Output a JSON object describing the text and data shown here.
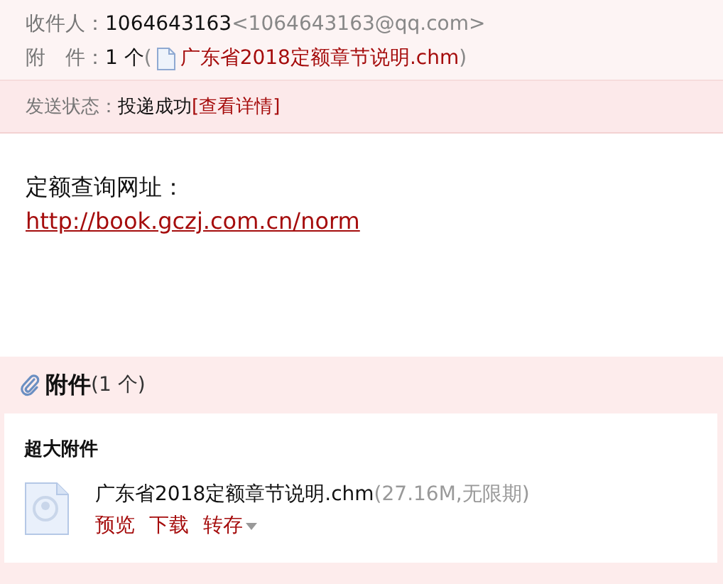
{
  "header": {
    "recipient_label": "收件人：",
    "recipient_name": "1064643163",
    "recipient_email": "<1064643163@qq.com>",
    "attachment_label": "附　件：",
    "attachment_count": "1 个",
    "open_paren": "(",
    "attachment_name": "广东省2018定额章节说明.chm",
    "close_paren": ")"
  },
  "status": {
    "label": "发送状态：",
    "value": "投递成功",
    "details_link": "[查看详情]"
  },
  "body": {
    "text": "定额查询网址：",
    "link": "http://book.gczj.com.cn/norm"
  },
  "attachments": {
    "title": "附件",
    "count": "(1 个)",
    "group": "超大附件",
    "files": [
      {
        "name": "广东省2018定额章节说明.chm",
        "info": "(27.16M,无限期)",
        "actions": [
          "预览",
          "下载",
          "转存"
        ]
      }
    ]
  }
}
